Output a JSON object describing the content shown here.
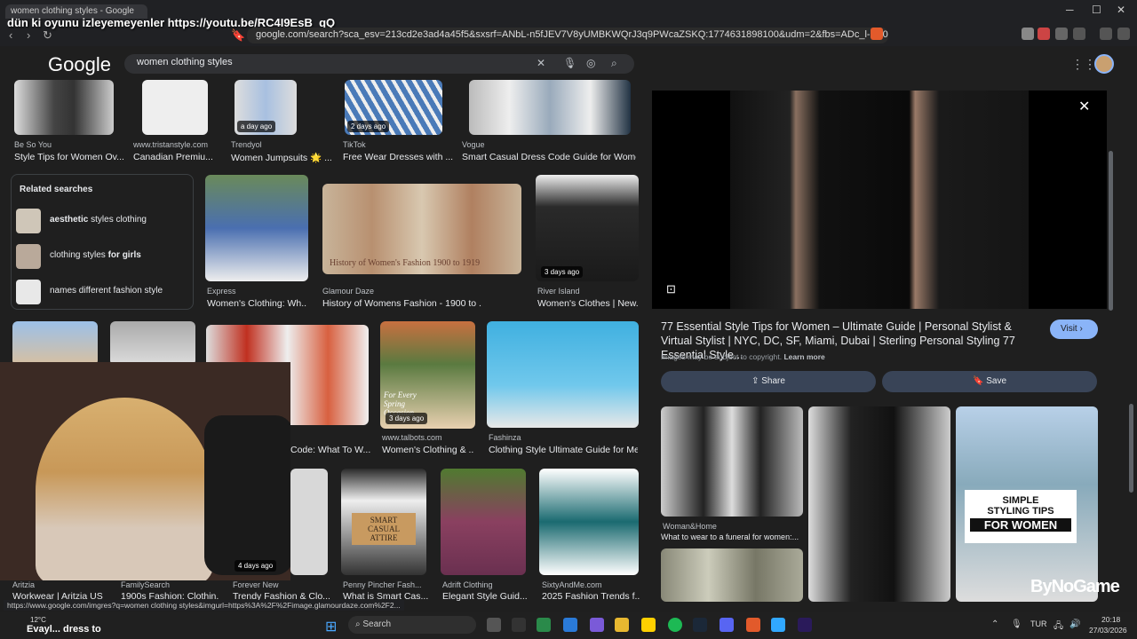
{
  "browser": {
    "tab_title": "women clothing styles - Google",
    "overlay_text": "dün ki oyunu izleyemeyenler https://youtu.be/RC4I9EsB_qQ",
    "url": "google.com/search?sca_esv=213cd2e3ad4a45f5&sxsrf=ANbL-n5fJEV7V8yUMBKWQrJ3q9PWcaZSKQ:1774631898100&udm=2&fbs=ADc_l-aN0CWEZBOHj...",
    "minimize": "─",
    "maximize": "☐",
    "close": "✕"
  },
  "google": {
    "logo": "Google",
    "query": "women clothing styles"
  },
  "top_row": [
    {
      "source": "Be So You",
      "title": "Style Tips for Women Ov...",
      "badge": ""
    },
    {
      "source": "www.tristanstyle.com",
      "title": "Canadian Premiu...",
      "badge": ""
    },
    {
      "source": "Trendyol",
      "title": "Women Jumpsuits 🌟 ...",
      "badge": "a day ago"
    },
    {
      "source": "TikTok",
      "title": "Free Wear Dresses with ...",
      "badge": "2 days ago"
    },
    {
      "source": "Vogue",
      "title": "Smart Casual Dress Code Guide for Wome...",
      "badge": ""
    }
  ],
  "related": {
    "heading": "Related searches",
    "items": [
      {
        "bold": "aesthetic",
        "rest": " styles clothing"
      },
      {
        "bold": "",
        "rest": "clothing styles ",
        "bold2": "for girls"
      },
      {
        "bold": "",
        "rest": "names different fashion style"
      }
    ]
  },
  "mid_row": [
    {
      "source": "Express",
      "title": "Women's Clothing: Wh...",
      "badge": ""
    },
    {
      "source": "Glamour Daze",
      "title": "History of Womens Fashion - 1900 to ...",
      "badge": "",
      "overlay": "History of Women's Fashion 1900 to 1919"
    },
    {
      "source": "River Island",
      "title": "Women's Clothes | New...",
      "badge": "3 days ago"
    }
  ],
  "row3": [
    {
      "source": "",
      "title": "Code: What To W...",
      "badge": ""
    },
    {
      "source": "www.talbots.com",
      "title": "Women's Clothing & ...",
      "badge": "3 days ago",
      "overlay": "For Every Spring Occasion"
    },
    {
      "source": "Fashinza",
      "title": "Clothing Style Ultimate Guide for Me...",
      "badge": ""
    }
  ],
  "row4": [
    {
      "source": "Aritzia",
      "title": "Workwear | Aritzia US",
      "badge": ""
    },
    {
      "source": "FamilySearch",
      "title": "1900s Fashion: Clothin...",
      "badge": ""
    },
    {
      "source": "Forever New",
      "title": "Trendy Fashion & Clo...",
      "badge": "4 days ago"
    },
    {
      "source": "Penny Pincher Fash...",
      "title": "What is Smart Cas...",
      "badge": "",
      "overlay": "SMART CASUAL ATTIRE"
    },
    {
      "source": "Adrift Clothing",
      "title": "Elegant Style Guid...",
      "badge": ""
    },
    {
      "source": "SixtyAndMe.com",
      "title": "2025 Fashion Trends f...",
      "badge": ""
    }
  ],
  "panel": {
    "title": "77 Essential Style Tips for Women – Ultimate Guide | Personal Stylist & Virtual Stylist | NYC, DC, SF, Miami, Dubai | Sterling Personal Styling 77 Essential Style...",
    "visit": "Visit",
    "copyright": "Images may be subject to copyright.",
    "learn_more": "Learn more",
    "share": "Share",
    "save": "Save",
    "related_source": "Woman&Home",
    "related_title": "What to wear to a funeral for women:...",
    "tips_overlay_1": "SIMPLE",
    "tips_overlay_2": "STYLING TIPS",
    "tips_overlay_3": "FOR WOMEN"
  },
  "status_url": "https://www.google.com/imgres?q=women clothing styles&imgurl=https%3A%2F%2Fimage.glamourdaze.com%2F2...",
  "watermark": "ByNoGame",
  "taskbar": {
    "weather": "12°C",
    "chat_text": "Evayl... dress to",
    "search": "Search",
    "lang": "TUR",
    "time": "20:18",
    "date": "27/03/2026"
  },
  "colors": {
    "accent": "#8ab4f8",
    "bg": "#1f1f1f",
    "button": "#394457"
  }
}
